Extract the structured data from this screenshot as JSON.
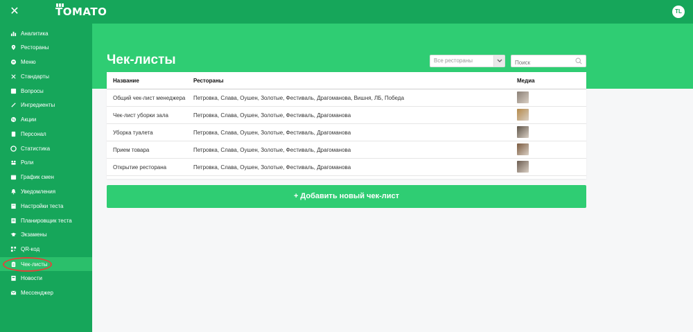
{
  "app": {
    "logo": "TOMATO",
    "user_initials": "TL"
  },
  "sidebar": {
    "items": [
      {
        "label": "Аналитика",
        "icon": "bar-chart-icon"
      },
      {
        "label": "Рестораны",
        "icon": "map-pin-icon"
      },
      {
        "label": "Меню",
        "icon": "menu-icon"
      },
      {
        "label": "Стандарты",
        "icon": "utensils-icon"
      },
      {
        "label": "Вопросы",
        "icon": "question-icon"
      },
      {
        "label": "Ингредиенты",
        "icon": "brush-icon"
      },
      {
        "label": "Акции",
        "icon": "percent-icon"
      },
      {
        "label": "Персонал",
        "icon": "id-card-icon"
      },
      {
        "label": "Статистика",
        "icon": "pie-chart-icon"
      },
      {
        "label": "Роли",
        "icon": "users-icon"
      },
      {
        "label": "График смен",
        "icon": "calendar-icon"
      },
      {
        "label": "Уведомления",
        "icon": "bell-icon"
      },
      {
        "label": "Настройки теста",
        "icon": "test-settings-icon"
      },
      {
        "label": "Планировщик теста",
        "icon": "planner-icon"
      },
      {
        "label": "Экзамены",
        "icon": "graduation-cap-icon"
      },
      {
        "label": "QR-код",
        "icon": "qr-code-icon"
      },
      {
        "label": "Чек-листы",
        "icon": "clipboard-icon",
        "active": true
      },
      {
        "label": "Новости",
        "icon": "news-icon"
      },
      {
        "label": "Мессенджер",
        "icon": "envelope-icon"
      }
    ]
  },
  "main": {
    "title": "Чек-листы",
    "filter": {
      "selected": "Все рестораны"
    },
    "search": {
      "placeholder": "Поиск"
    },
    "table": {
      "headers": [
        "Название",
        "Рестораны",
        "Медиа"
      ],
      "rows": [
        {
          "name": "Общий чек-лист менеджера",
          "restaurants": "Петровка, Слава, Оушен, Золотые, Фестиваль, Драгоманова, Вишня, ЛБ, Победа",
          "media_color": "#8a7f76"
        },
        {
          "name": "Чек-лист уборки зала",
          "restaurants": "Петровка, Слава, Оушен, Золотые, Фестиваль, Драгоманова",
          "media_color": "#b58a4a"
        },
        {
          "name": "Уборка туалета",
          "restaurants": "Петровка, Слава, Оушен, Золотые, Фестиваль, Драгоманова",
          "media_color": "#5e5448"
        },
        {
          "name": "Прием товара",
          "restaurants": "Петровка, Слава, Оушен, Золотые, Фестиваль, Драгоманова",
          "media_color": "#7a5a3e"
        },
        {
          "name": "Открытие ресторана",
          "restaurants": "Петровка, Слава, Оушен, Золотые, Фестиваль, Драгоманова",
          "media_color": "#6b5c50"
        }
      ]
    },
    "add_button": "+ Добавить новый чек-лист"
  },
  "colors": {
    "sidebar": "#16a65a",
    "accent": "#2fcd73",
    "highlight": "#e0443a"
  }
}
